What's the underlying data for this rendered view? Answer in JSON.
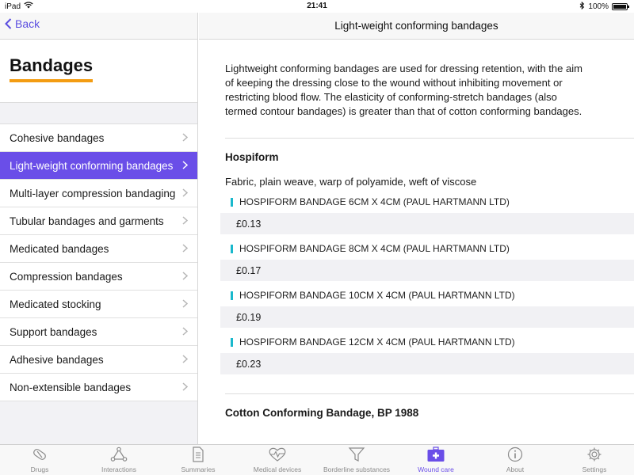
{
  "status": {
    "device": "iPad",
    "time": "21:41",
    "battery": "100%",
    "battery_level": 1.0
  },
  "left": {
    "back_label": "Back",
    "heading": "Bandages",
    "items": [
      {
        "label": "Cohesive bandages",
        "active": false
      },
      {
        "label": "Light-weight conforming bandages",
        "active": true
      },
      {
        "label": "Multi-layer compression bandaging",
        "active": false
      },
      {
        "label": "Tubular bandages and garments",
        "active": false
      },
      {
        "label": "Medicated bandages",
        "active": false
      },
      {
        "label": "Compression bandages",
        "active": false
      },
      {
        "label": "Medicated stocking",
        "active": false
      },
      {
        "label": "Support bandages",
        "active": false
      },
      {
        "label": "Adhesive bandages",
        "active": false
      },
      {
        "label": "Non-extensible bandages",
        "active": false
      }
    ]
  },
  "right": {
    "title": "Light-weight conforming bandages",
    "intro": "Lightweight conforming bandages are used for dressing retention, with the aim of keeping the dressing close to the wound without inhibiting movement or restricting blood flow. The elasticity of conforming-stretch bandages (also termed contour bandages) is greater than that of cotton conforming bandages.",
    "sections": [
      {
        "title": "Hospiform",
        "description": "Fabric, plain weave, warp of polyamide, weft of viscose",
        "products": [
          {
            "name": "HOSPIFORM BANDAGE 6CM X 4CM (PAUL HARTMANN LTD)",
            "price": "£0.13"
          },
          {
            "name": "HOSPIFORM BANDAGE 8CM X 4CM (PAUL HARTMANN LTD)",
            "price": "£0.17"
          },
          {
            "name": "HOSPIFORM BANDAGE 10CM X 4CM (PAUL HARTMANN LTD)",
            "price": "£0.19"
          },
          {
            "name": "HOSPIFORM BANDAGE 12CM X 4CM (PAUL HARTMANN LTD)",
            "price": "£0.23"
          }
        ]
      },
      {
        "title": "Cotton Conforming Bandage, BP 1988"
      }
    ]
  },
  "tabs": [
    {
      "label": "Drugs",
      "icon": "pill-icon",
      "active": false
    },
    {
      "label": "Interactions",
      "icon": "interactions-icon",
      "active": false
    },
    {
      "label": "Summaries",
      "icon": "document-icon",
      "active": false
    },
    {
      "label": "Medical devices",
      "icon": "heart-pulse-icon",
      "active": false
    },
    {
      "label": "Borderline substances",
      "icon": "funnel-icon",
      "active": false
    },
    {
      "label": "Wound care",
      "icon": "medical-kit-icon",
      "active": true
    },
    {
      "label": "About",
      "icon": "info-icon",
      "active": false
    },
    {
      "label": "Settings",
      "icon": "gear-icon",
      "active": false
    }
  ],
  "colors": {
    "accent": "#6a4ee8",
    "heading_underline": "#f39c12",
    "product_marker": "#19b8cc"
  }
}
